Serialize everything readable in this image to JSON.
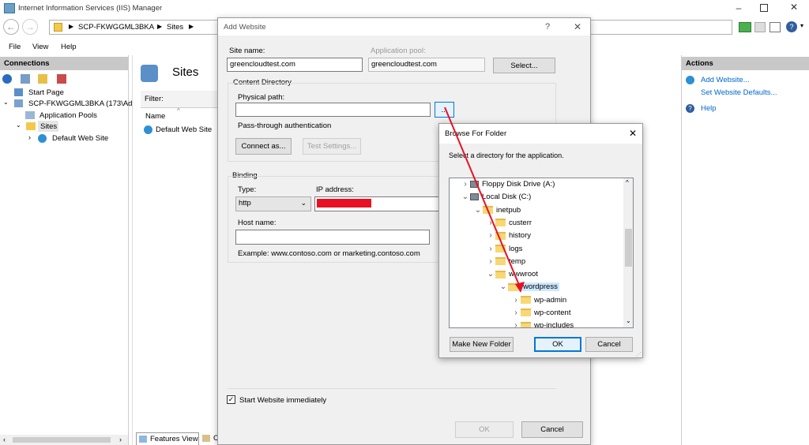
{
  "window": {
    "title": "Internet Information Services (IIS) Manager",
    "breadcrumb": [
      "SCP-FKWGGML3BKA",
      "Sites"
    ],
    "menu": [
      "File",
      "View",
      "Help"
    ]
  },
  "connections": {
    "header": "Connections",
    "tree": {
      "start_page": "Start Page",
      "server": "SCP-FKWGGML3BKA (173\\Ad",
      "app_pools": "Application Pools",
      "sites": "Sites",
      "default_site": "Default Web Site"
    }
  },
  "center": {
    "title": "Sites",
    "filter_label": "Filter:",
    "name_col": "Name",
    "default_site": "Default Web Site",
    "features_view_tab": "Features View",
    "content_tab_partial": "C"
  },
  "actions": {
    "header": "Actions",
    "add_website": "Add Website...",
    "set_defaults": "Set Website Defaults...",
    "help": "Help"
  },
  "add_website": {
    "title": "Add Website",
    "help_glyph": "?",
    "site_name_label": "Site name:",
    "site_name_value": "greencloudtest.com",
    "app_pool_label": "Application pool:",
    "app_pool_value": "greencloudtest.com",
    "select_button": "Select...",
    "content_dir_label": "Content Directory",
    "physical_path_label": "Physical path:",
    "physical_path_value": "",
    "browse_button": "...",
    "pass_through_label": "Pass-through authentication",
    "connect_as_button": "Connect as...",
    "test_settings_button": "Test Settings...",
    "binding_label": "Binding",
    "type_label": "Type:",
    "type_value": "http",
    "ip_label": "IP address:",
    "host_name_label": "Host name:",
    "host_name_value": "",
    "example_text": "Example: www.contoso.com or marketing.contoso.com",
    "start_immediately_label": "Start Website immediately",
    "start_immediately_checked": true,
    "ok_button": "OK",
    "cancel_button": "Cancel"
  },
  "browse_folder": {
    "title": "Browse For Folder",
    "instruction": "Select a directory for the application.",
    "items": [
      {
        "label": "Floppy Disk Drive (A:)",
        "icon": "floppy-icon",
        "chevron": ">"
      },
      {
        "label": "Local Disk (C:)",
        "icon": "disk-icon",
        "chevron": "v"
      },
      {
        "label": "inetpub",
        "icon": "folder-icon",
        "chevron": "v"
      },
      {
        "label": "custerr",
        "icon": "folder-icon",
        "chevron": ">"
      },
      {
        "label": "history",
        "icon": "folder-icon",
        "chevron": ">"
      },
      {
        "label": "logs",
        "icon": "folder-icon",
        "chevron": ">"
      },
      {
        "label": "temp",
        "icon": "folder-icon",
        "chevron": ">"
      },
      {
        "label": "wwwroot",
        "icon": "folder-icon",
        "chevron": "v"
      },
      {
        "label": "wordpress",
        "icon": "folder-icon",
        "chevron": "v",
        "selected": true
      },
      {
        "label": "wp-admin",
        "icon": "folder-icon",
        "chevron": ">"
      },
      {
        "label": "wp-content",
        "icon": "folder-icon",
        "chevron": ">"
      },
      {
        "label": "wp-includes",
        "icon": "folder-icon",
        "chevron": ">"
      }
    ],
    "make_new_folder_button": "Make New Folder",
    "ok_button": "OK",
    "cancel_button": "Cancel",
    "close_glyph": "✕"
  },
  "colors": {
    "accent": "#0078d7",
    "selection": "#cce8ff",
    "annotation_red": "#e81123",
    "link": "#0066cc"
  }
}
